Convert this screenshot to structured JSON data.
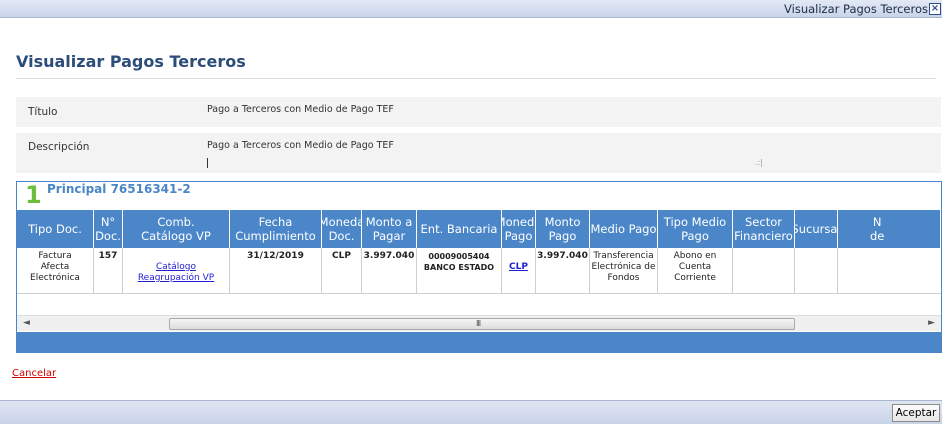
{
  "window": {
    "title": "Visualizar Pagos Terceros",
    "close_glyph": "×"
  },
  "page": {
    "title": "Visualizar Pagos Terceros"
  },
  "form": {
    "titulo_label": "Título",
    "titulo_value": "Pago a Terceros con Medio de Pago TEF",
    "descripcion_label": "Descripción",
    "descripcion_value": "Pago a Terceros con Medio de Pago TEF"
  },
  "panel": {
    "number": "1",
    "title": "Principal 76516341-2",
    "columns": [
      "Tipo Doc.",
      "N°\nDoc.",
      "Comb.\nCatálogo VP",
      "Fecha\nCumplimiento",
      "Moneda\nDoc.",
      "Monto a\nPagar",
      "Ent. Bancaria",
      "Moneda\nPago",
      "Monto\nPago",
      "Medio Pago",
      "Tipo Medio\nPago",
      "Sector\nFinanciero",
      "Sucursal",
      "N\nde"
    ],
    "row": {
      "tipo_doc": "Factura\nAfecta\nElectrónica",
      "n_doc": "157",
      "comb_catalogo": "Catálogo\nReagrupación VP",
      "fecha": "31/12/2019",
      "moneda_doc": "CLP",
      "monto_pagar": "3.997.040",
      "ent_bancaria": "00009005404\nBANCO ESTADO",
      "moneda_pago": "CLP",
      "monto_pago": "3.997.040",
      "medio_pago": "Transferencia\nElectrónica de\nFondos",
      "tipo_medio_pago": "Abono en\nCuenta\nCorriente",
      "sector_financiero": "",
      "sucursal": "",
      "n_de": ""
    },
    "scroll_left_glyph": "◄",
    "scroll_right_glyph": "►",
    "scroll_grip": "III"
  },
  "actions": {
    "cancel_label": "Cancelar",
    "accept_label": "Aceptar"
  },
  "colors": {
    "accent": "#4a86c8",
    "title": "#2c4c79",
    "number": "#6bbf3a",
    "cancel": "#d00000"
  }
}
